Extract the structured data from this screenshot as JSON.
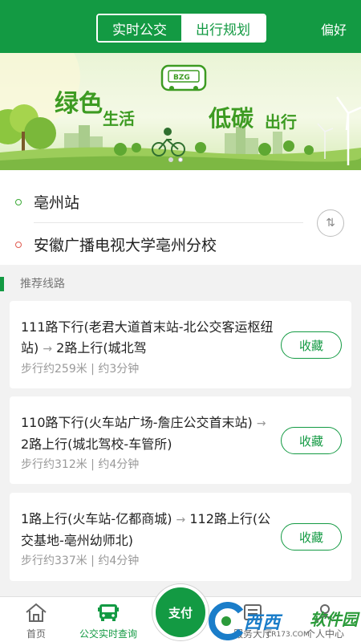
{
  "header": {
    "tabs": [
      {
        "label": "实时公交",
        "active": true
      },
      {
        "label": "出行规划",
        "active": false
      }
    ],
    "preference_label": "偏好"
  },
  "banner": {
    "slogan_green": "绿色",
    "slogan_life": "生活",
    "slogan_low": "低碳",
    "slogan_travel": "出行",
    "logo_text": "BZG",
    "current_slide": 2,
    "slide_count": 2
  },
  "route": {
    "origin": "亳州站",
    "destination": "安徽广播电视大学亳州分校",
    "swap_icon": "swap-vertical-icon"
  },
  "section": {
    "title": "推荐线路"
  },
  "routes": [
    {
      "line_a": "111路下行(老君大道首末站-北公交客运枢纽站)",
      "line_b": "2路上行(城北驾",
      "walk": "步行约259米",
      "time": "约3分钟",
      "fav_label": "收藏"
    },
    {
      "line_a": "110路下行(火车站广场-詹庄公交首末站)",
      "line_b": "2路上行(城北驾校-车管所)",
      "walk": "步行约312米",
      "time": "约4分钟",
      "fav_label": "收藏"
    },
    {
      "line_a": "1路上行(火车站-亿都商城)",
      "line_b": "112路上行(公交基地-亳州幼师北)",
      "walk": "步行约337米",
      "time": "约4分钟",
      "fav_label": "收藏"
    }
  ],
  "nav": {
    "items": [
      {
        "label": "首页",
        "icon": "home-icon",
        "active": false
      },
      {
        "label": "公交实时查询",
        "icon": "bus-icon",
        "active": true
      },
      {
        "label": "服务大厅",
        "icon": "service-icon",
        "active": false
      },
      {
        "label": "个人中心",
        "icon": "user-icon",
        "active": false
      }
    ],
    "pay_label": "支付"
  },
  "watermark": {
    "brand": "西西",
    "brand_right": "软件园",
    "url": "CR173.COM"
  },
  "colors": {
    "primary": "#139a43",
    "origin_dot": "#3aaa35",
    "destination_dot": "#e05a4f"
  }
}
